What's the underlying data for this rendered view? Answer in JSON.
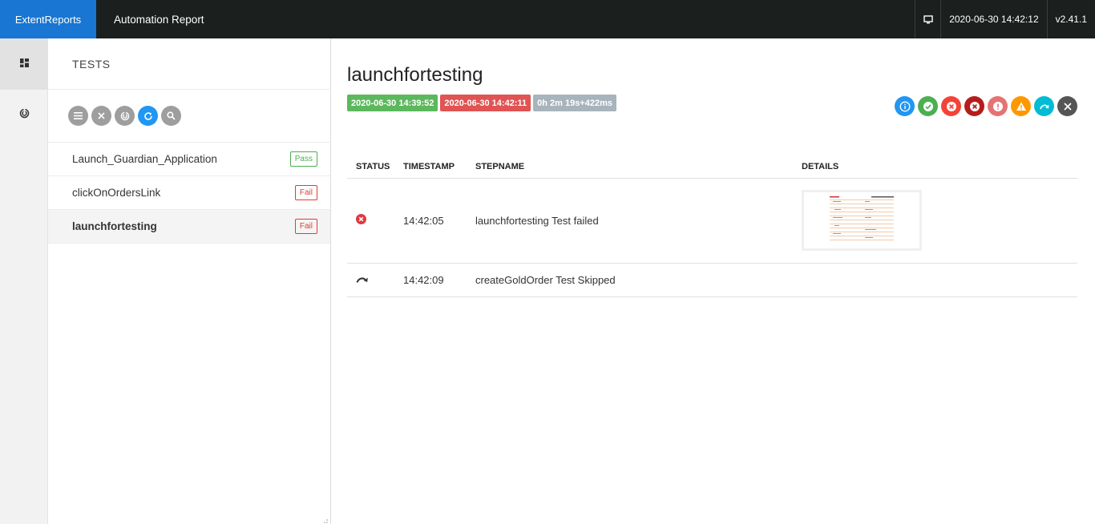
{
  "topbar": {
    "brand": "ExtentReports",
    "report_name": "Automation Report",
    "timestamp": "2020-06-30 14:42:12",
    "version": "v2.41.1",
    "monitor_icon": "monitor-icon"
  },
  "leftnav": {
    "items": [
      {
        "icon": "dashboard-icon",
        "active": true
      },
      {
        "icon": "analytics-icon",
        "active": false
      }
    ]
  },
  "tests_panel": {
    "heading": "TESTS",
    "filter_icons": [
      "list-icon",
      "close-icon",
      "analytics-icon",
      "refresh-icon",
      "search-icon"
    ],
    "tests": [
      {
        "name": "Launch_Guardian_Application",
        "status": "Pass"
      },
      {
        "name": "clickOnOrdersLink",
        "status": "Fail"
      },
      {
        "name": "launchfortesting",
        "status": "Fail"
      }
    ]
  },
  "detail": {
    "title": "launchfortesting",
    "start_time": "2020-06-30 14:39:52",
    "end_time": "2020-06-30 14:42:11",
    "duration": "0h 2m 19s+422ms",
    "status_filters": [
      {
        "icon": "info-icon",
        "color": "#2196f3"
      },
      {
        "icon": "pass-icon",
        "color": "#4caf50"
      },
      {
        "icon": "fail-icon",
        "color": "#f44336"
      },
      {
        "icon": "fatal-icon",
        "color": "#b71c1c"
      },
      {
        "icon": "error-icon",
        "color": "#e57373"
      },
      {
        "icon": "warning-icon",
        "color": "#ff9800"
      },
      {
        "icon": "skip-icon",
        "color": "#00bcd4"
      },
      {
        "icon": "clear-icon",
        "color": "#555555"
      }
    ],
    "columns": [
      "STATUS",
      "TIMESTAMP",
      "STEPNAME",
      "DETAILS"
    ],
    "steps": [
      {
        "status_icon": "fail-icon",
        "timestamp": "14:42:05",
        "stepname": "launchfortesting Test failed",
        "details": "screenshot"
      },
      {
        "status_icon": "skip-icon",
        "timestamp": "14:42:09",
        "stepname": "createGoldOrder Test Skipped",
        "details": ""
      }
    ]
  }
}
